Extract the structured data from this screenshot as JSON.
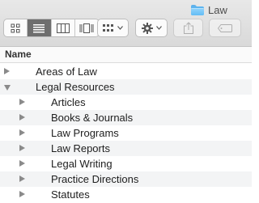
{
  "window": {
    "title": "Law"
  },
  "toolbar": {
    "view_modes": [
      {
        "name": "icon-view",
        "icon": "grid-icon",
        "active": false
      },
      {
        "name": "list-view",
        "icon": "list-icon",
        "active": true
      },
      {
        "name": "column-view",
        "icon": "columns-icon",
        "active": false
      },
      {
        "name": "gallery-view",
        "icon": "coverflow-icon",
        "active": false
      }
    ],
    "arrange_icon": "group-icon",
    "action_icon": "gear-icon",
    "share_icon": "share-icon",
    "tag_icon": "tag-icon",
    "accent": "#6e6e6e"
  },
  "columns": {
    "name": "Name"
  },
  "rows": [
    {
      "label": "Areas of Law",
      "level": 0,
      "expanded": false
    },
    {
      "label": "Legal Resources",
      "level": 0,
      "expanded": true
    },
    {
      "label": "Articles",
      "level": 1,
      "expanded": false
    },
    {
      "label": "Books & Journals",
      "level": 1,
      "expanded": false
    },
    {
      "label": "Law Programs",
      "level": 1,
      "expanded": false
    },
    {
      "label": "Law Reports",
      "level": 1,
      "expanded": false
    },
    {
      "label": "Legal Writing",
      "level": 1,
      "expanded": false
    },
    {
      "label": "Practice Directions",
      "level": 1,
      "expanded": false
    },
    {
      "label": "Statutes",
      "level": 1,
      "expanded": false
    }
  ],
  "colors": {
    "folder": "#5cb4ef",
    "stripe": "#f3f4f5"
  }
}
